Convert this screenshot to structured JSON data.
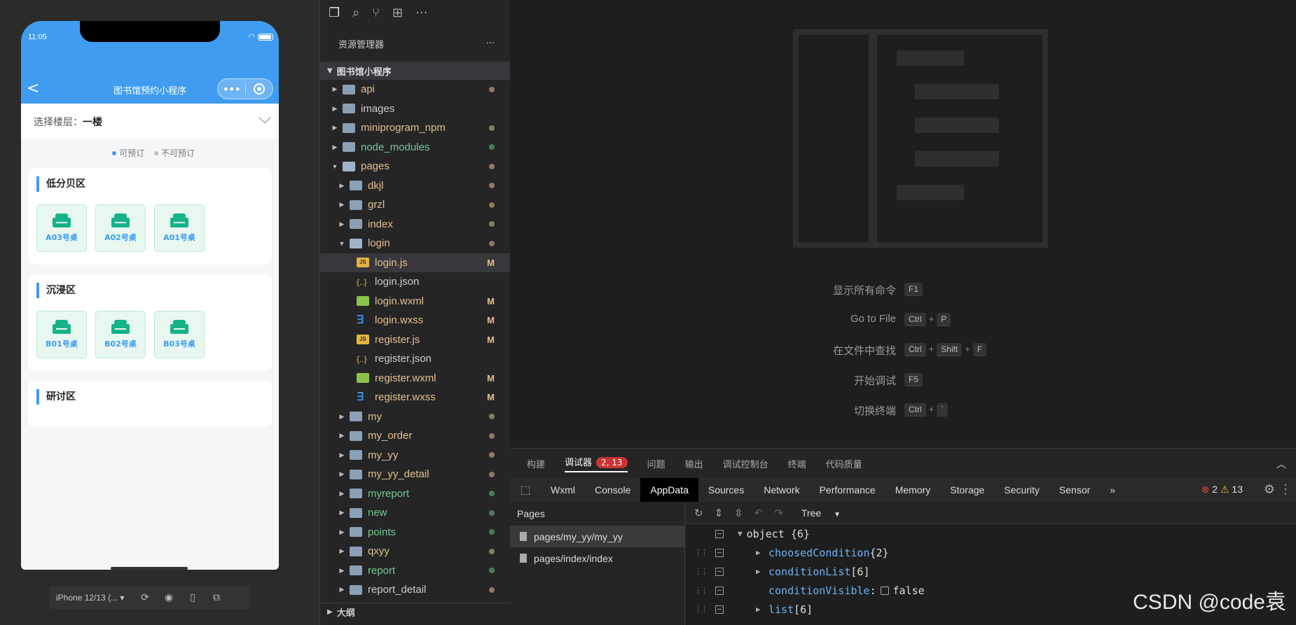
{
  "simulator": {
    "time": "11:05",
    "nav_back": "<",
    "title": "图书馆预约小程序",
    "capsule_more": "•••",
    "floor_label": "选择楼层：",
    "floor_value": "一楼",
    "legend_available": "可预订",
    "legend_unavailable": "不可预订",
    "legend_available_color": "#3f9cf0",
    "legend_unavailable_color": "#bbbbbb",
    "zones": [
      {
        "title": "低分贝区",
        "seats": [
          "A03号桌",
          "A02号桌",
          "A01号桌"
        ]
      },
      {
        "title": "沉浸区",
        "seats": [
          "B01号桌",
          "B02号桌",
          "B03号桌"
        ]
      },
      {
        "title": "研讨区",
        "seats": []
      }
    ],
    "device_select": "iPhone 12/13 (... ▾"
  },
  "explorer": {
    "header": "资源管理器",
    "header_more": "···",
    "project": "图书馆小程序",
    "outline": "大纲",
    "items": [
      {
        "label": "api",
        "depth": 0,
        "type": "folder",
        "color": "#e2c08d",
        "status": "dot",
        "status_color": "#8b7d5a",
        "expanded": false
      },
      {
        "label": "images",
        "depth": 0,
        "type": "folder",
        "color": "#cccccc",
        "status": "",
        "status_color": "",
        "expanded": false
      },
      {
        "label": "miniprogram_npm",
        "depth": 0,
        "type": "folder",
        "color": "#e2c08d",
        "status": "dot",
        "status_color": "#8b7d5a",
        "expanded": false
      },
      {
        "label": "node_modules",
        "depth": 0,
        "type": "folder",
        "color": "#73c991",
        "status": "dot",
        "status_color": "#4c7a5a",
        "expanded": false
      },
      {
        "label": "pages",
        "depth": 0,
        "type": "folder-open",
        "color": "#e2c08d",
        "status": "dot",
        "status_color": "#8b7d5a",
        "expanded": true
      },
      {
        "label": "dkjl",
        "depth": 1,
        "type": "folder",
        "color": "#e2c08d",
        "status": "dot",
        "status_color": "#8b7d5a",
        "expanded": false
      },
      {
        "label": "grzl",
        "depth": 1,
        "type": "folder",
        "color": "#e2c08d",
        "status": "dot",
        "status_color": "#8b7d5a",
        "expanded": false
      },
      {
        "label": "index",
        "depth": 1,
        "type": "folder",
        "color": "#e2c08d",
        "status": "dot",
        "status_color": "#8b7d5a",
        "expanded": false
      },
      {
        "label": "login",
        "depth": 1,
        "type": "folder-open",
        "color": "#e2c08d",
        "status": "dot",
        "status_color": "#8b7d5a",
        "expanded": true
      },
      {
        "label": "login.js",
        "depth": 2,
        "type": "js",
        "color": "#e2c08d",
        "status": "M",
        "status_color": "#e2c08d",
        "selected": true
      },
      {
        "label": "login.json",
        "depth": 2,
        "type": "json",
        "color": "#cccccc",
        "status": "",
        "status_color": ""
      },
      {
        "label": "login.wxml",
        "depth": 2,
        "type": "wxml",
        "color": "#e2c08d",
        "status": "M",
        "status_color": "#e2c08d"
      },
      {
        "label": "login.wxss",
        "depth": 2,
        "type": "wxss",
        "color": "#e2c08d",
        "status": "M",
        "status_color": "#e2c08d"
      },
      {
        "label": "register.js",
        "depth": 2,
        "type": "js",
        "color": "#e2c08d",
        "status": "M",
        "status_color": "#e2c08d"
      },
      {
        "label": "register.json",
        "depth": 2,
        "type": "json",
        "color": "#cccccc",
        "status": "",
        "status_color": ""
      },
      {
        "label": "register.wxml",
        "depth": 2,
        "type": "wxml",
        "color": "#e2c08d",
        "status": "M",
        "status_color": "#e2c08d"
      },
      {
        "label": "register.wxss",
        "depth": 2,
        "type": "wxss",
        "color": "#e2c08d",
        "status": "M",
        "status_color": "#e2c08d"
      },
      {
        "label": "my",
        "depth": 1,
        "type": "folder",
        "color": "#e2c08d",
        "status": "dot",
        "status_color": "#8b7d5a",
        "expanded": false
      },
      {
        "label": "my_order",
        "depth": 1,
        "type": "folder",
        "color": "#e2c08d",
        "status": "dot",
        "status_color": "#8b7d5a",
        "expanded": false
      },
      {
        "label": "my_yy",
        "depth": 1,
        "type": "folder",
        "color": "#e2c08d",
        "status": "dot",
        "status_color": "#8b7d5a",
        "expanded": false
      },
      {
        "label": "my_yy_detail",
        "depth": 1,
        "type": "folder",
        "color": "#e2c08d",
        "status": "dot",
        "status_color": "#8b7d5a",
        "expanded": false
      },
      {
        "label": "myreport",
        "depth": 1,
        "type": "folder",
        "color": "#73c991",
        "status": "dot",
        "status_color": "#4c7a5a",
        "expanded": false
      },
      {
        "label": "new",
        "depth": 1,
        "type": "folder",
        "color": "#73c991",
        "status": "dot",
        "status_color": "#4c7a5a",
        "expanded": false
      },
      {
        "label": "points",
        "depth": 1,
        "type": "folder",
        "color": "#73c991",
        "status": "dot",
        "status_color": "#4c7a5a",
        "expanded": false
      },
      {
        "label": "qxyy",
        "depth": 1,
        "type": "folder",
        "color": "#e2c08d",
        "status": "dot",
        "status_color": "#8b7d5a",
        "expanded": false
      },
      {
        "label": "report",
        "depth": 1,
        "type": "folder",
        "color": "#73c991",
        "status": "dot",
        "status_color": "#4c7a5a",
        "expanded": false
      },
      {
        "label": "report_detail",
        "depth": 1,
        "type": "folder",
        "color": "#cccccc",
        "status": "dot",
        "status_color": "#8b7d5a",
        "expanded": false
      }
    ]
  },
  "editor": {
    "commands": [
      {
        "label": "显示所有命令",
        "keys": [
          "F1"
        ]
      },
      {
        "label": "Go to File",
        "keys": [
          "Ctrl",
          "P"
        ]
      },
      {
        "label": "在文件中查找",
        "keys": [
          "Ctrl",
          "Shift",
          "F"
        ]
      },
      {
        "label": "开始调试",
        "keys": [
          "F5"
        ]
      },
      {
        "label": "切换终端",
        "keys": [
          "Ctrl",
          "`"
        ]
      }
    ]
  },
  "devtools": {
    "tabs": [
      "构建",
      "调试器",
      "问题",
      "输出",
      "调试控制台",
      "终端",
      "代码质量"
    ],
    "active_tab": 1,
    "debugger_badge": "2, 13",
    "panel_tabs": [
      "Wxml",
      "Console",
      "AppData",
      "Sources",
      "Network",
      "Performance",
      "Memory",
      "Storage",
      "Security",
      "Sensor"
    ],
    "active_panel": 2,
    "panel_overflow": "»",
    "error_count": "2",
    "warning_count": "13",
    "pages_header": "Pages",
    "pages": [
      "pages/my_yy/my_yy",
      "pages/index/index"
    ],
    "active_page": 0,
    "tree_mode": "Tree",
    "root": "object {6}",
    "rows": [
      {
        "key": "choosedCondition",
        "value": "{2}",
        "expandable": true,
        "checkbox": false
      },
      {
        "key": "conditionList",
        "value": "[6]",
        "expandable": true,
        "checkbox": false
      },
      {
        "key": "conditionVisible",
        "value": "false",
        "expandable": false,
        "checkbox": true
      },
      {
        "key": "list",
        "value": "[6]",
        "expandable": true,
        "checkbox": false
      }
    ]
  },
  "watermark": "CSDN @code袁"
}
